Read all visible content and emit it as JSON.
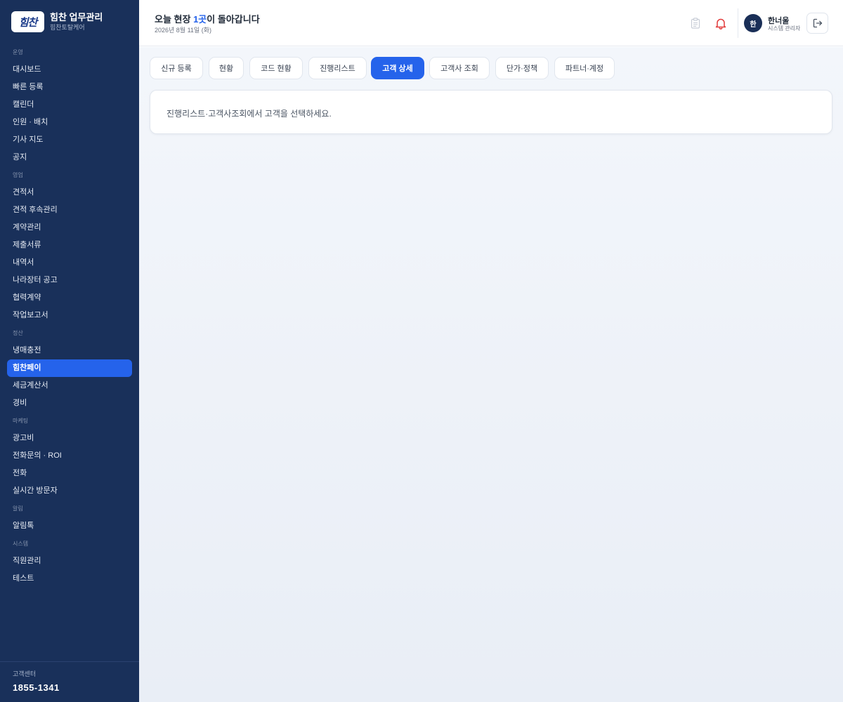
{
  "brand": {
    "logo_text": "힘찬",
    "title": "힘찬 업무관리",
    "subtitle": "힘찬토탈케어"
  },
  "sidebar": {
    "sections": [
      {
        "label": "운영",
        "items": [
          "대시보드",
          "빠른 등록",
          "캘린더",
          "인원 · 배치",
          "기사 지도",
          "공지"
        ]
      },
      {
        "label": "영업",
        "items": [
          "견적서",
          "견적 후속관리",
          "계약관리",
          "제출서류",
          "내역서",
          "나라장터 공고",
          "협력계약",
          "작업보고서"
        ]
      },
      {
        "label": "정산",
        "items": [
          "냉매충전",
          "힘찬페이",
          "세금계산서",
          "경비"
        ]
      },
      {
        "label": "마케팅",
        "items": [
          "광고비",
          "전화문의 · ROI",
          "전화",
          "실시간 방문자"
        ]
      },
      {
        "label": "알림",
        "items": [
          "알림톡"
        ]
      },
      {
        "label": "시스템",
        "items": [
          "직원관리",
          "테스트"
        ]
      }
    ],
    "active_item": "힘찬페이",
    "footer": {
      "label": "고객센터",
      "phone": "1855-1341"
    }
  },
  "header": {
    "greeting_prefix": "오늘 현장 ",
    "greeting_count": "1곳",
    "greeting_suffix": "이 돌아갑니다",
    "date": "2026년 8월 11일 (화)",
    "icons": [
      "clipboard-icon",
      "bell-icon",
      "logout-icon"
    ],
    "user": {
      "avatar": "한",
      "name": "한너울",
      "role": "시스템 관리자"
    }
  },
  "tabs": [
    {
      "label": "신규 등록",
      "active": false
    },
    {
      "label": "현황",
      "active": false
    },
    {
      "label": "코드 현황",
      "active": false
    },
    {
      "label": "진행리스트",
      "active": false
    },
    {
      "label": "고객 상세",
      "active": true
    },
    {
      "label": "고객사 조회",
      "active": false
    },
    {
      "label": "단가·정책",
      "active": false
    },
    {
      "label": "파트너·계정",
      "active": false
    }
  ],
  "notice": {
    "text": "진행리스트·고객사조회에서 고객을 선택하세요."
  },
  "colors": {
    "sidebar": "#19305a",
    "accent": "#2563eb",
    "bell": "#e23b3b"
  }
}
